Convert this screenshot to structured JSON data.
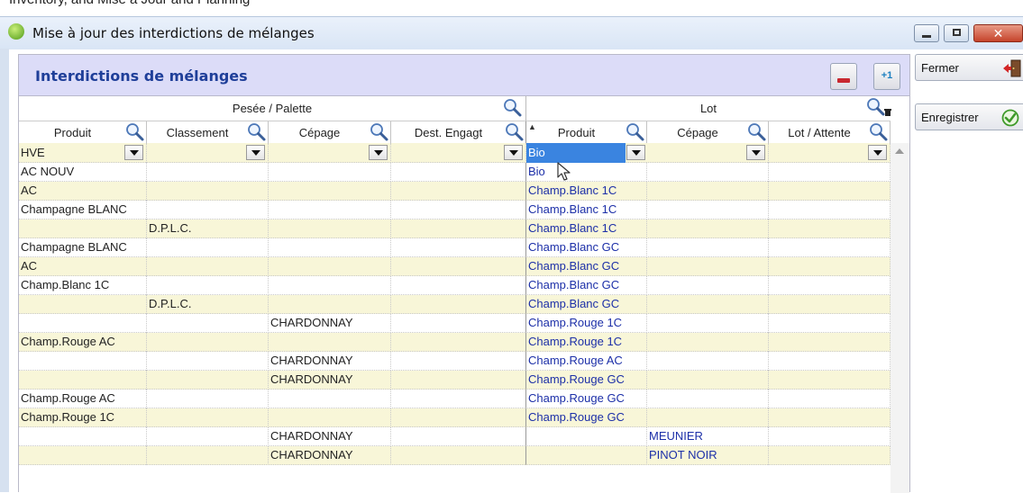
{
  "window": {
    "top_strip_text": "Inventory, and Mise à Jour and Planning",
    "title": "Mise à jour des interdictions de mélanges",
    "minimize_glyph": "",
    "maximize_glyph": "",
    "close_glyph": "✕"
  },
  "panel": {
    "title": "Interdictions de mélanges"
  },
  "toolbar": {
    "plus_label": "+1"
  },
  "side_buttons": {
    "close_label": "Fermer",
    "save_label": "Enregistrer"
  },
  "groups": {
    "left": "Pesée / Palette",
    "right": "Lot"
  },
  "columns": [
    {
      "key": "produit",
      "label": "Produit"
    },
    {
      "key": "classement",
      "label": "Classement"
    },
    {
      "key": "cepage",
      "label": "Cépage"
    },
    {
      "key": "dest",
      "label": "Dest. Engagt"
    },
    {
      "key": "lot_produit",
      "label": "Produit"
    },
    {
      "key": "lot_cepage",
      "label": "Cépage"
    },
    {
      "key": "lot_attente",
      "label": "Lot / Attente"
    }
  ],
  "filters": {
    "produit": "HVE",
    "classement": "",
    "cepage": "",
    "dest": "",
    "lot_produit": "Bio",
    "lot_cepage": "",
    "lot_attente": ""
  },
  "rows": [
    [
      "AC NOUV",
      "",
      "",
      "",
      "Bio",
      "",
      ""
    ],
    [
      "AC",
      "",
      "",
      "",
      "Champ.Blanc 1C",
      "",
      ""
    ],
    [
      "Champagne BLANC",
      "",
      "",
      "",
      "Champ.Blanc 1C",
      "",
      ""
    ],
    [
      "",
      "D.P.L.C.",
      "",
      "",
      "Champ.Blanc 1C",
      "",
      ""
    ],
    [
      "Champagne BLANC",
      "",
      "",
      "",
      "Champ.Blanc GC",
      "",
      ""
    ],
    [
      "AC",
      "",
      "",
      "",
      "Champ.Blanc GC",
      "",
      ""
    ],
    [
      "Champ.Blanc 1C",
      "",
      "",
      "",
      "Champ.Blanc GC",
      "",
      ""
    ],
    [
      "",
      "D.P.L.C.",
      "",
      "",
      "Champ.Blanc GC",
      "",
      ""
    ],
    [
      "",
      "",
      "CHARDONNAY",
      "",
      "Champ.Rouge 1C",
      "",
      ""
    ],
    [
      "Champ.Rouge AC",
      "",
      "",
      "",
      "Champ.Rouge 1C",
      "",
      ""
    ],
    [
      "",
      "",
      "CHARDONNAY",
      "",
      "Champ.Rouge AC",
      "",
      ""
    ],
    [
      "",
      "",
      "CHARDONNAY",
      "",
      "Champ.Rouge GC",
      "",
      ""
    ],
    [
      "Champ.Rouge AC",
      "",
      "",
      "",
      "Champ.Rouge GC",
      "",
      ""
    ],
    [
      "Champ.Rouge 1C",
      "",
      "",
      "",
      "Champ.Rouge GC",
      "",
      ""
    ],
    [
      "",
      "",
      "CHARDONNAY",
      "",
      "",
      "MEUNIER",
      ""
    ],
    [
      "",
      "",
      "CHARDONNAY",
      "",
      "",
      "PINOT NOIR",
      ""
    ]
  ],
  "colors": {
    "panel_title": "#1f3f99",
    "panel_header_bg": "#dcdcf8",
    "row_alt_bg": "#f8f6d8",
    "lot_text": "#1c2fa8",
    "selection": "#3a84e0"
  },
  "icons": {
    "app": "app-leaf-icon",
    "search": "search-icon",
    "dropdown": "chevron-down-icon",
    "close_door": "door-exit-icon",
    "save": "check-circle-icon",
    "delete": "minus-icon",
    "add": "plus-one-icon",
    "cursor": "mouse-pointer-icon"
  }
}
